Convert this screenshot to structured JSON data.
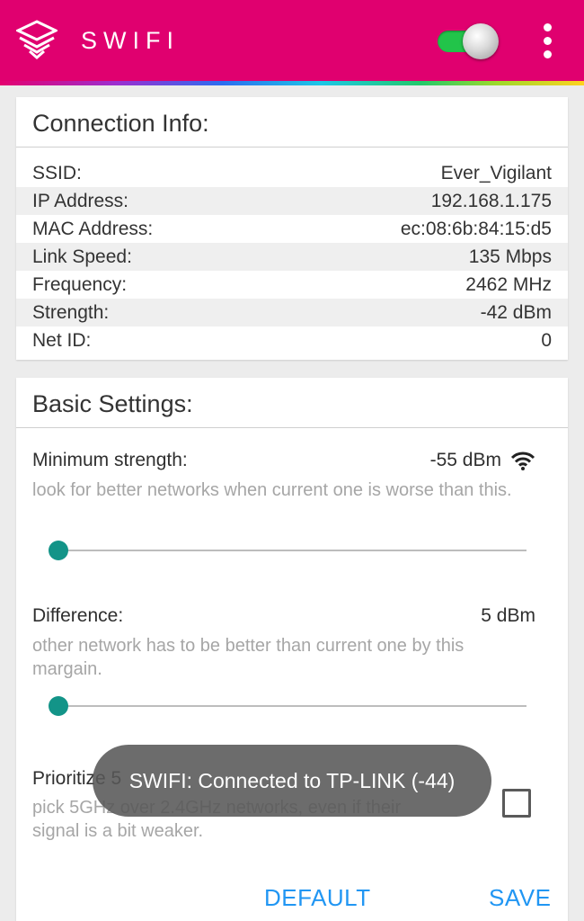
{
  "app": {
    "title": "SWIFI",
    "logo_icon": "layered-diamond-icon",
    "toggle_on": true,
    "menu_icon": "overflow-menu-icon"
  },
  "colors": {
    "appbar": "#e0006f",
    "accent": "#139488",
    "button": "#2196f3",
    "toggle": "#22c44a"
  },
  "connection": {
    "title": "Connection Info:",
    "rows": [
      {
        "label": "SSID:",
        "value": "Ever_Vigilant"
      },
      {
        "label": "IP Address:",
        "value": "192.168.1.175"
      },
      {
        "label": "MAC Address:",
        "value": "ec:08:6b:84:15:d5"
      },
      {
        "label": "Link Speed:",
        "value": "135 Mbps"
      },
      {
        "label": "Frequency:",
        "value": "2462 MHz"
      },
      {
        "label": "Strength:",
        "value": "-42 dBm"
      },
      {
        "label": "Net ID:",
        "value": "0"
      }
    ]
  },
  "basic": {
    "title": "Basic Settings:",
    "min_strength": {
      "label": "Minimum strength:",
      "value": "-55 dBm",
      "icon": "wifi-icon",
      "desc": "look for better networks when current one is worse than this.",
      "slider_fraction": 0.0
    },
    "difference": {
      "label": "Difference:",
      "value": "5 dBm",
      "desc": "other network has to be better than current one by this margain.",
      "slider_fraction": 0.0
    },
    "prioritize": {
      "label": "Prioritize 5",
      "desc": "pick 5GHz over 2.4GHz networks, even if their signal is a bit weaker.",
      "checked": false
    },
    "default_button": "DEFAULT",
    "save_button": "SAVE"
  },
  "toast": "SWIFI: Connected to TP-LINK (-44)"
}
